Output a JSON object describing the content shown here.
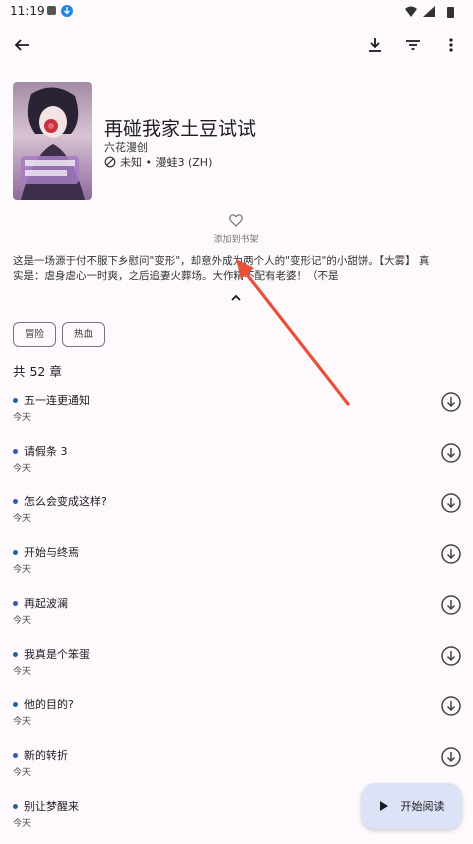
{
  "status_bar": {
    "time": "11:19"
  },
  "manga": {
    "title": "再碰我家土豆试试",
    "author": "六花漫创",
    "meta": "未知 • 漫蛙3 (ZH)",
    "favorite_label": "添加到书架",
    "description_line1": "这是一场源于付不服下乡慰问\"变形\"，却意外成为两个人的\"变形记\"的小甜饼。【大雾】 真",
    "description_line2": "实是：虐身虐心一时爽，之后追妻火葬场。大作精不配有老婆！（不是",
    "tags": [
      "冒险",
      "热血"
    ],
    "chapter_count": "共 52 章"
  },
  "chapters": [
    {
      "title": "五一连更通知",
      "date": "今天"
    },
    {
      "title": "请假条 3",
      "date": "今天"
    },
    {
      "title": "怎么会变成这样?",
      "date": "今天"
    },
    {
      "title": "开始与终焉",
      "date": "今天"
    },
    {
      "title": "再起波澜",
      "date": "今天"
    },
    {
      "title": "我真是个笨蛋",
      "date": "今天"
    },
    {
      "title": "他的目的?",
      "date": "今天"
    },
    {
      "title": "新的转折",
      "date": "今天"
    },
    {
      "title": "别让梦醒来",
      "date": "今天"
    }
  ],
  "fab": {
    "label": "开始阅读"
  },
  "colors": {
    "background": "#fdf9fc",
    "accent": "#2a5ea8",
    "fab_bg": "#dde3f6",
    "annotation_arrow": "#e8503a"
  }
}
